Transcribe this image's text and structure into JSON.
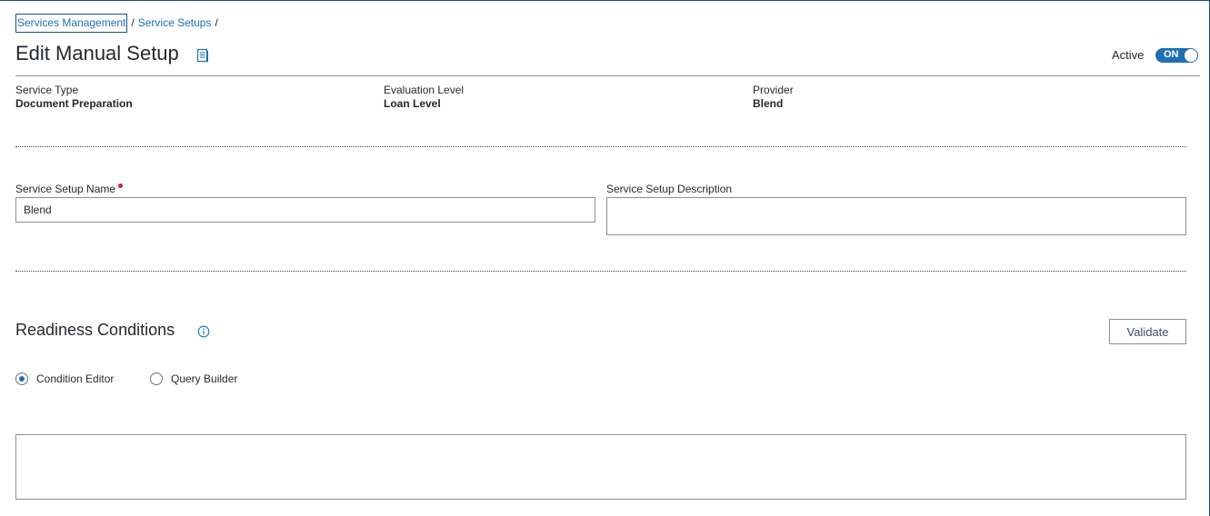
{
  "breadcrumb": {
    "items": [
      "Services Management",
      "Service Setups"
    ],
    "separator": "/"
  },
  "header": {
    "title": "Edit Manual Setup",
    "title_icon": "document-icon",
    "active_label": "Active",
    "toggle_text": "ON",
    "toggle_state": true
  },
  "info": {
    "service_type": {
      "label": "Service Type",
      "value": "Document Preparation"
    },
    "evaluation_level": {
      "label": "Evaluation Level",
      "value": "Loan Level"
    },
    "provider": {
      "label": "Provider",
      "value": "Blend"
    }
  },
  "form": {
    "setup_name": {
      "label": "Service Setup Name",
      "value": "Blend",
      "required": true
    },
    "setup_description": {
      "label": "Service Setup Description",
      "value": ""
    }
  },
  "readiness": {
    "title": "Readiness Conditions",
    "info_icon": "info-icon",
    "validate_label": "Validate",
    "options": [
      {
        "label": "Condition Editor",
        "selected": true
      },
      {
        "label": "Query Builder",
        "selected": false
      }
    ],
    "condition_text": ""
  },
  "colors": {
    "accent": "#1e6fb5",
    "required": "#d6202f",
    "text": "#25292f"
  }
}
